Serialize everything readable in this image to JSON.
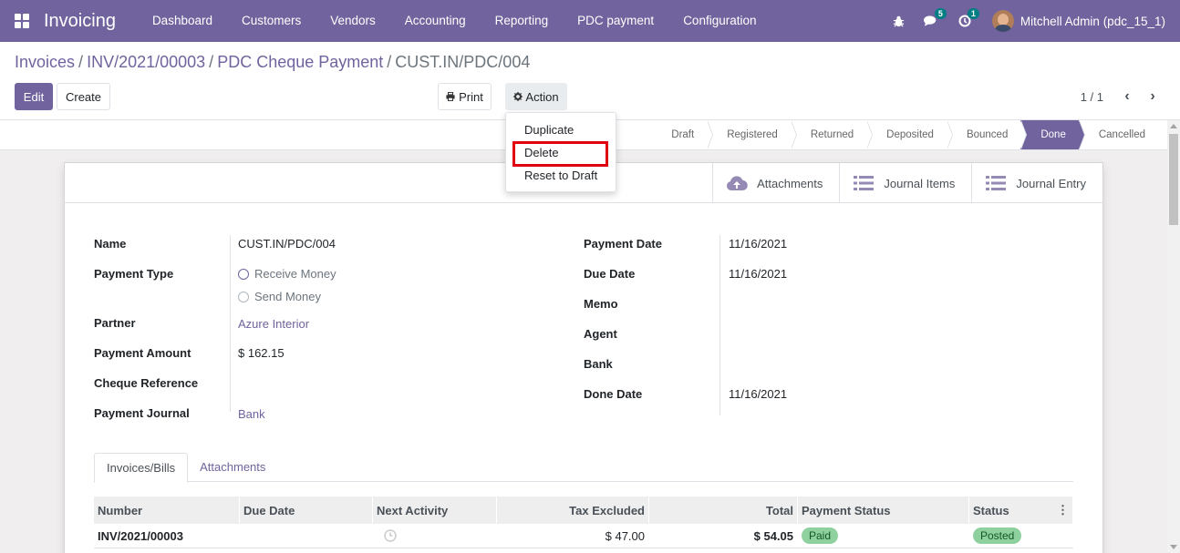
{
  "app": {
    "title": "Invoicing"
  },
  "menu": [
    "Dashboard",
    "Customers",
    "Vendors",
    "Accounting",
    "Reporting",
    "PDC payment",
    "Configuration"
  ],
  "navbar": {
    "messages_count": "5",
    "activities_count": "1",
    "user": "Mitchell Admin (pdc_15_1)"
  },
  "breadcrumb": [
    "Invoices",
    "INV/2021/00003",
    "PDC Cheque Payment",
    "CUST.IN/PDC/004"
  ],
  "buttons": {
    "edit": "Edit",
    "create": "Create",
    "print": "Print",
    "action": "Action"
  },
  "pager": {
    "value": "1 / 1"
  },
  "action_menu": [
    "Duplicate",
    "Delete",
    "Reset to Draft"
  ],
  "stages": [
    "Draft",
    "Registered",
    "Returned",
    "Deposited",
    "Bounced",
    "Done",
    "Cancelled"
  ],
  "active_stage": "Done",
  "smart_buttons": [
    "Attachments",
    "Journal Items",
    "Journal Entry"
  ],
  "form": {
    "left": {
      "name_label": "Name",
      "name": "CUST.IN/PDC/004",
      "payment_type_label": "Payment Type",
      "payment_type_options": [
        "Receive Money",
        "Send Money"
      ],
      "partner_label": "Partner",
      "partner": "Azure Interior",
      "amount_label": "Payment Amount",
      "amount": "$ 162.15",
      "cheque_label": "Cheque Reference",
      "cheque": "",
      "journal_label": "Payment Journal",
      "journal": "Bank"
    },
    "right": {
      "payment_date_label": "Payment Date",
      "payment_date": "11/16/2021",
      "due_date_label": "Due Date",
      "due_date": "11/16/2021",
      "memo_label": "Memo",
      "memo": "",
      "agent_label": "Agent",
      "agent": "",
      "bank_label": "Bank",
      "bank": "",
      "done_date_label": "Done Date",
      "done_date": "11/16/2021"
    }
  },
  "tabs": [
    "Invoices/Bills",
    "Attachments"
  ],
  "table": {
    "headers": [
      "Number",
      "Due Date",
      "Next Activity",
      "Tax Excluded",
      "Total",
      "Payment Status",
      "Status"
    ],
    "rows": [
      {
        "number": "INV/2021/00003",
        "due_date": "",
        "next_activity": "",
        "tax_excluded": "$ 47.00",
        "total": "$ 54.05",
        "payment_status": "Paid",
        "status": "Posted"
      }
    ]
  },
  "colors": {
    "brand": "#71639e",
    "highlight": "#e0000f",
    "badge": "#017e84",
    "paid": "#8fd19e"
  }
}
